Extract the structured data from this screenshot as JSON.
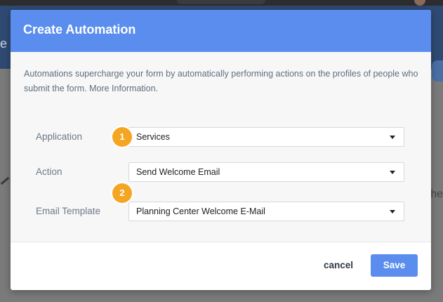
{
  "modal": {
    "title": "Create Automation",
    "intro": "Automations supercharge your form by automatically performing actions on the profiles of people who submit the form. More Information.",
    "fields": [
      {
        "label": "Application",
        "value": "Services"
      },
      {
        "label": "Action",
        "value": "Send Welcome Email"
      },
      {
        "label": "Email Template",
        "value": "Planning Center Welcome E-Mail"
      }
    ],
    "badges": [
      "1",
      "2"
    ],
    "cancel_label": "cancel",
    "save_label": "Save"
  },
  "colors": {
    "header_blue": "#5a8ded",
    "badge_orange": "#f4a622"
  },
  "icons": {
    "select_caret": "caret-down-icon"
  }
}
